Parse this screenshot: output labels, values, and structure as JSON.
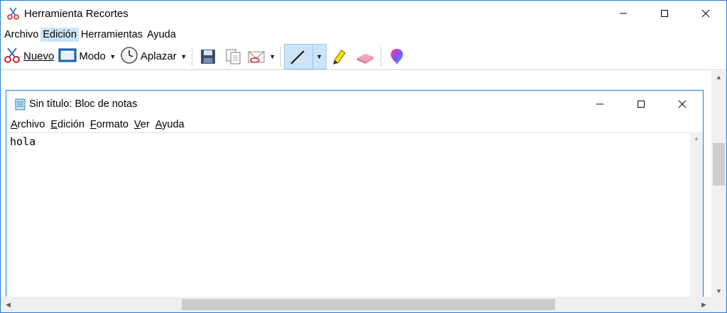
{
  "window": {
    "title": "Herramienta Recortes",
    "icon": "snipping-scissors-icon"
  },
  "menubar": {
    "items": [
      "Archivo",
      "Edición",
      "Herramientas",
      "Ayuda"
    ],
    "active": "Edición"
  },
  "toolbar": {
    "new_label": "Nuevo",
    "mode_label": "Modo",
    "delay_label": "Aplazar",
    "icons": [
      "save-icon",
      "copy-icon",
      "send-email-icon",
      "pen-icon",
      "highlighter-icon",
      "eraser-icon",
      "paint3d-icon"
    ]
  },
  "notepad": {
    "title": "Sin título: Bloc de notas",
    "menu": [
      {
        "first": "A",
        "rest": "rchivo"
      },
      {
        "first": "E",
        "rest": "dición"
      },
      {
        "first": "F",
        "rest": "ormato"
      },
      {
        "first": "V",
        "rest": "er"
      },
      {
        "first": "A",
        "rest": "yuda"
      }
    ],
    "content": "hola"
  },
  "colors": {
    "accent": "#1883d7",
    "menu_highlight": "#cce4f7",
    "scrollbar_track": "#f0f0f0",
    "scrollbar_thumb": "#cdcdcd"
  }
}
